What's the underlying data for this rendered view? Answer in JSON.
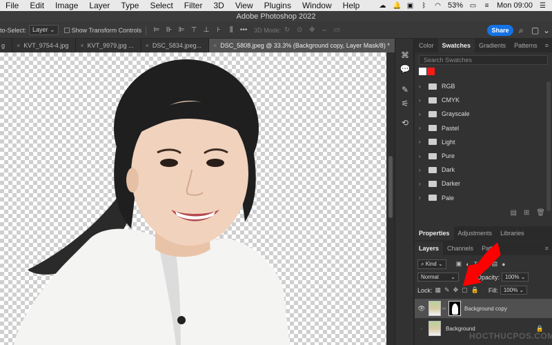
{
  "menubar": {
    "items": [
      "File",
      "Edit",
      "Image",
      "Layer",
      "Type",
      "Select",
      "Filter",
      "3D",
      "View",
      "Plugins",
      "Window",
      "Help"
    ],
    "battery": "53%",
    "clock": "Mon 09:00"
  },
  "titlebar": {
    "title": "Adobe Photoshop 2022"
  },
  "options": {
    "auto_select_label": "to-Select:",
    "auto_select_value": "Layer",
    "show_transform": "Show Transform Controls",
    "mode_3d": "3D Mode:",
    "share": "Share"
  },
  "tabs": [
    {
      "label": "g"
    },
    {
      "label": "KVT_9754-4.jpg"
    },
    {
      "label": "KVT_9979.jpg ..."
    },
    {
      "label": "DSC_5834.jpeg..."
    },
    {
      "label": "DSC_5808.jpeg @ 33.3% (Background copy, Layer Mask/8) *"
    }
  ],
  "swatches_panel": {
    "tabs": [
      "Color",
      "Swatches",
      "Gradients",
      "Patterns"
    ],
    "active_tab": "Swatches",
    "search_placeholder": "Search Swatches",
    "recent_colors": [
      "#ffffff",
      "#ff1a1a"
    ],
    "folders": [
      "RGB",
      "CMYK",
      "Grayscale",
      "Pastel",
      "Light",
      "Pure",
      "Dark",
      "Darker",
      "Pale"
    ]
  },
  "properties_panel": {
    "tabs": [
      "Properties",
      "Adjustments",
      "Libraries"
    ],
    "active_tab": "Properties"
  },
  "layers_panel": {
    "tabs": [
      "Layers",
      "Channels",
      "Paths"
    ],
    "active_tab": "Layers",
    "filter_kind": "Kind",
    "blend_mode": "Normal",
    "opacity_label": "Opacity:",
    "opacity_value": "100%",
    "lock_label": "Lock:",
    "fill_label": "Fill:",
    "fill_value": "100%",
    "layers": [
      {
        "name": "Background copy",
        "selected": true
      },
      {
        "name": "Background",
        "selected": false
      }
    ]
  },
  "watermark": "HOCTHUCPOS.COM",
  "colors": {
    "accent": "#1473e6",
    "arrow": "#ff0000"
  }
}
